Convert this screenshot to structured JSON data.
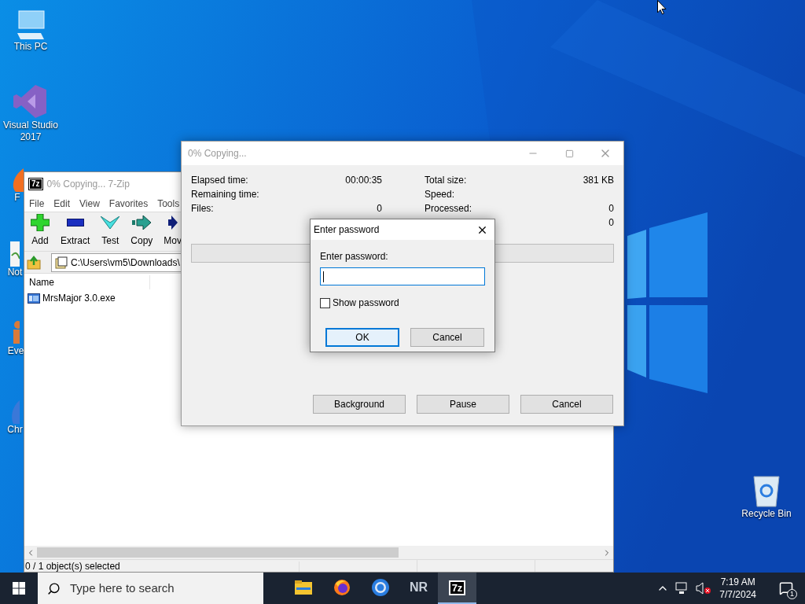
{
  "desktop_icons": [
    {
      "label": "This PC",
      "kind": "pc"
    },
    {
      "label": "Visual Studio 2017",
      "kind": "vs"
    },
    {
      "label": "F",
      "kind": "browser"
    },
    {
      "label": "Not",
      "kind": "notepad"
    },
    {
      "label": "Eve",
      "kind": "person"
    },
    {
      "label": "Chr",
      "kind": "chrome"
    },
    {
      "label": "Recycle Bin",
      "kind": "bin"
    }
  ],
  "main_window": {
    "icon_text": "7z",
    "title": "0% Copying... 7-Zip",
    "menu": [
      "File",
      "Edit",
      "View",
      "Favorites",
      "Tools"
    ],
    "toolbar": [
      {
        "label": "Add",
        "kind": "add"
      },
      {
        "label": "Extract",
        "kind": "extract"
      },
      {
        "label": "Test",
        "kind": "test"
      },
      {
        "label": "Copy",
        "kind": "copy"
      },
      {
        "label": "Mov",
        "kind": "move"
      }
    ],
    "address": "C:\\Users\\vm5\\Downloads\\",
    "columns": [
      "Name"
    ],
    "files": [
      "MrsMajor 3.0.exe"
    ],
    "status": "0 / 1 object(s) selected"
  },
  "copy_dialog": {
    "title": "0% Copying...",
    "stats_left": [
      {
        "label": "Elapsed time:",
        "value": "00:00:35"
      },
      {
        "label": "Remaining time:"
      },
      {
        "label": "Files:",
        "value": "0"
      }
    ],
    "stats_right": [
      {
        "label": "Total size:",
        "value": "381 KB"
      },
      {
        "label": "Speed:"
      },
      {
        "label": "Processed:",
        "value": "0"
      },
      {
        "value": "0"
      }
    ],
    "progress": {
      "level": 0
    },
    "buttons": [
      "Background",
      "Pause",
      "Cancel"
    ]
  },
  "password_dialog": {
    "title": "Enter password",
    "label": "Enter password:",
    "focused": true,
    "show_password": {
      "label": "Show password",
      "checked": false
    },
    "buttons": [
      {
        "label": "OK",
        "default": true
      },
      {
        "label": "Cancel",
        "default": false
      }
    ]
  },
  "taskbar": {
    "search_placeholder": "Type here to search",
    "apps": [
      {
        "kind": "folder",
        "selected": false
      },
      {
        "kind": "firefox",
        "selected": false
      },
      {
        "kind": "chrome",
        "selected": false
      },
      {
        "kind": "text",
        "label": "NR",
        "selected": false
      },
      {
        "kind": "sevenzip",
        "label": "7z",
        "selected": true
      }
    ],
    "time": "7:19 AM",
    "date": "7/7/2024",
    "notification_count": "1"
  }
}
